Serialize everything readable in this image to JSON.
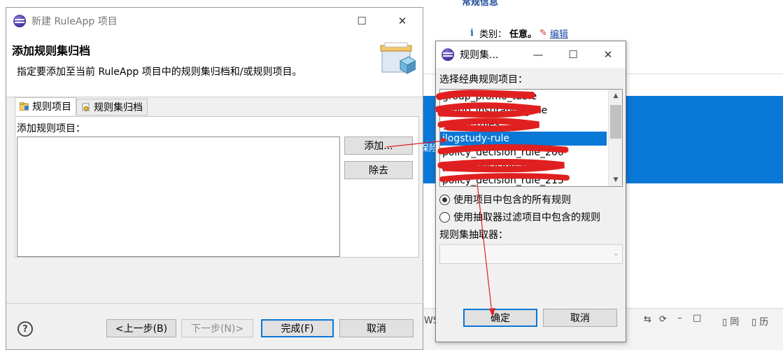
{
  "background": {
    "header_title": "常规信息",
    "info_prefix": "类别：",
    "info_value": "任意。",
    "edit_link": "编辑",
    "blue_text_1": "保险",
    "blue_text_2": "保险",
    "bottom_tabs": [
      "同",
      "历"
    ],
    "bottom_partial": "DWS"
  },
  "wizard": {
    "title": "新建 RuleApp 项目",
    "heading": "添加规则集归档",
    "description": "指定要添加至当前 RuleApp 项目中的规则集归档和/或规则项目。",
    "tabs": [
      {
        "label": "规则项目",
        "active": true
      },
      {
        "label": "规则集归档",
        "active": false
      }
    ],
    "list_label": "添加规则项目：",
    "add_button": "添加...",
    "remove_button": "除去",
    "back_button": "<上一步(B)",
    "next_button": "下一步(N)>",
    "finish_button": "完成(F)",
    "cancel_button": "取消",
    "help_icon": "?"
  },
  "ruleset_dialog": {
    "title": "规则集...",
    "select_label": "选择经典规则项目：",
    "rule_projects": [
      "group_promo_table",
      "group_insurance_rule",
      "group_rules",
      "ilogstudy-rule",
      "policy_decision_rule_200",
      "policy_decision_rule",
      "policy_decision_rule_213"
    ],
    "selected_index": 3,
    "radio_all": "使用项目中包含的所有规则",
    "radio_extractor": "使用抽取器过滤项目中包含的规则",
    "radio_selected": "all",
    "extractor_label": "规则集抽取器：",
    "extractor_value": "",
    "ok_button": "确定",
    "cancel_button": "取消"
  },
  "colors": {
    "selection": "#0a78d6",
    "annotation": "#e02020"
  }
}
